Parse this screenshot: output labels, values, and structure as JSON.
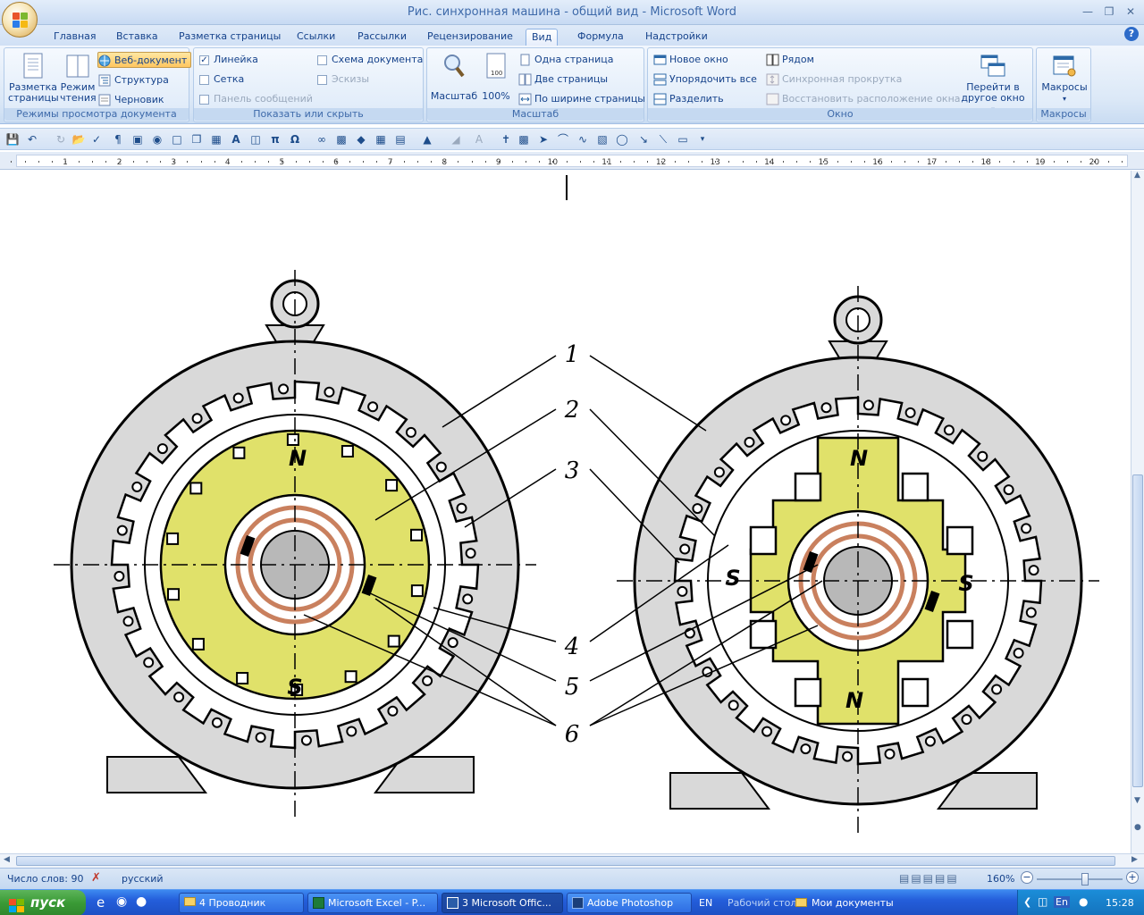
{
  "window": {
    "title": "Рис. синхронная машина - общий вид - Microsoft Word"
  },
  "tabs": [
    "Главная",
    "Вставка",
    "Разметка страницы",
    "Ссылки",
    "Рассылки",
    "Рецензирование",
    "Вид",
    "Формула",
    "Надстройки"
  ],
  "active_tab": "Вид",
  "ribbon": {
    "views": {
      "label": "Режимы просмотра документа",
      "print_layout": "Разметка страницы",
      "reading": "Режим чтения",
      "web": "Веб-документ",
      "outline": "Структура",
      "draft": "Черновик"
    },
    "show": {
      "label": "Показать или скрыть",
      "ruler": "Линейка",
      "grid": "Сетка",
      "message_bar": "Панель сообщений",
      "doc_map": "Схема документа",
      "thumbnails": "Эскизы",
      "ruler_checked": "✓"
    },
    "zoom": {
      "label": "Масштаб",
      "zoom_btn": "Масштаб",
      "hundred": "100%",
      "one_page": "Одна страница",
      "two_pages": "Две страницы",
      "page_width": "По ширине страницы"
    },
    "window": {
      "label": "Окно",
      "new_window": "Новое окно",
      "arrange_all": "Упорядочить все",
      "split": "Разделить",
      "side_by_side": "Рядом",
      "sync_scroll": "Синхронная прокрутка",
      "reset_position": "Восстановить расположение окна",
      "switch_window": "Перейти в другое окно"
    },
    "macros": {
      "label": "Макросы",
      "btn": "Макросы"
    }
  },
  "ruler": {
    "numbers": [
      "1",
      "2",
      "3",
      "4",
      "5",
      "6",
      "7",
      "8",
      "9",
      "10",
      "11",
      "12",
      "13",
      "14",
      "15",
      "16",
      "17",
      "18",
      "19",
      "20"
    ]
  },
  "figure": {
    "callouts": [
      "1",
      "2",
      "3",
      "4",
      "5",
      "6"
    ],
    "poles_left": [
      "N",
      "S"
    ],
    "poles_right": [
      "N",
      "S",
      "S",
      "N"
    ]
  },
  "status": {
    "word_count": "Число слов: 90",
    "language": "русский",
    "zoom": "160%"
  },
  "taskbar": {
    "start": "пуск",
    "buttons": [
      "4 Проводник",
      "Microsoft Excel - P...",
      "3 Microsoft Offic...",
      "Adobe Photoshop"
    ],
    "lang": "EN",
    "desktop": "Рабочий стол",
    "my_docs": "Мои документы",
    "tray_lang": "En",
    "clock": "15:28"
  },
  "colors": {
    "rotor_yellow": "#e0e16a",
    "stator_gray": "#d9d9d9",
    "ring_copper": "#c9805e",
    "accent_blue": "#15428b"
  }
}
